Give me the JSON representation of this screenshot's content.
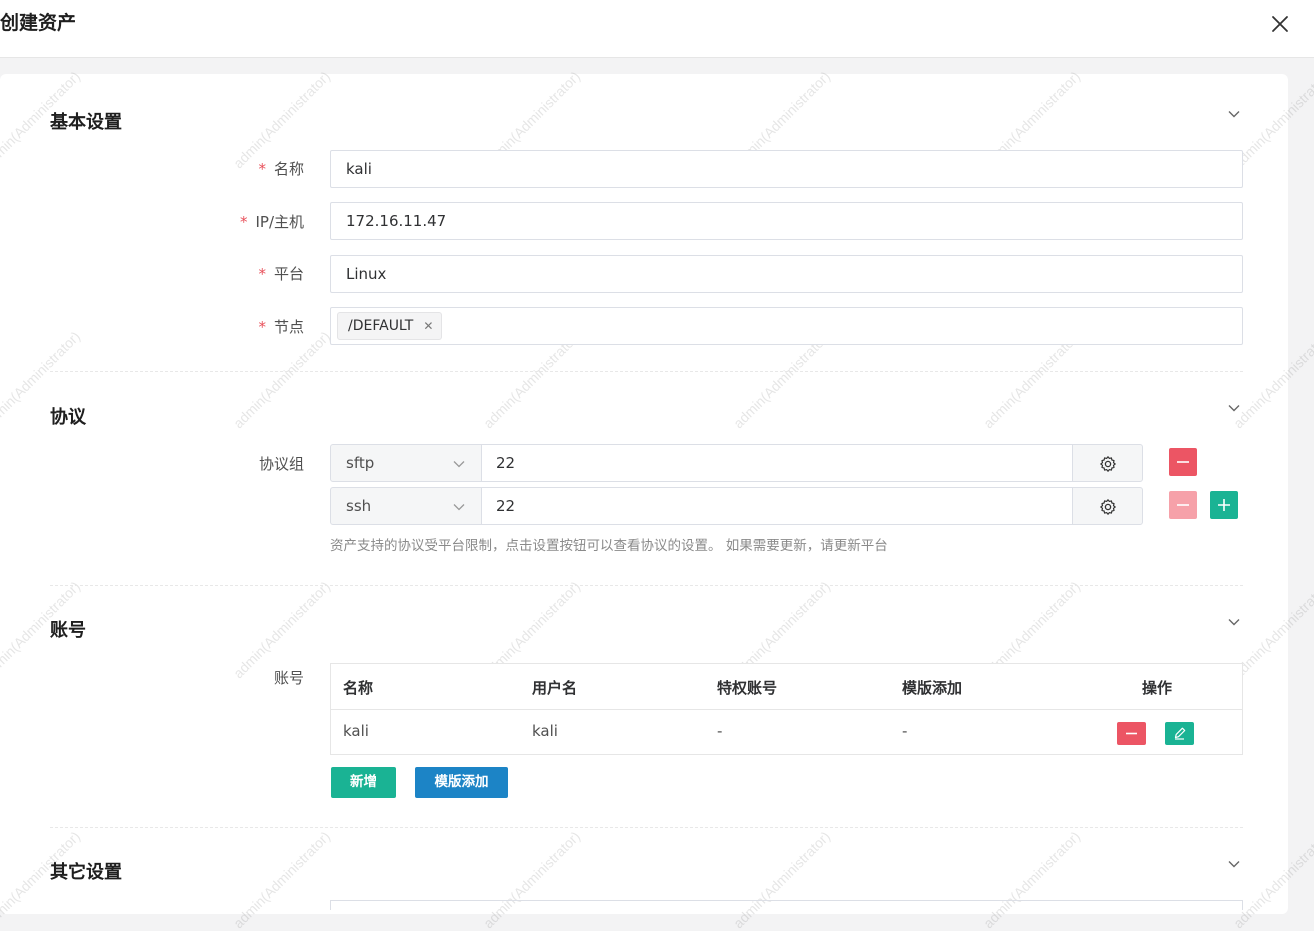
{
  "dialog": {
    "title": "创建资产"
  },
  "watermark": {
    "text": "admin(Administrator)"
  },
  "sections": {
    "basic": {
      "title": "基本设置"
    },
    "protocol": {
      "title": "协议"
    },
    "account": {
      "title": "账号"
    },
    "other": {
      "title": "其它设置"
    }
  },
  "basic": {
    "name_label": "名称",
    "name_value": "kali",
    "ip_label": "IP/主机",
    "ip_value": "172.16.11.47",
    "platform_label": "平台",
    "platform_value": "Linux",
    "node_label": "节点",
    "node_tag": "/DEFAULT",
    "required_mark": "*"
  },
  "protocol": {
    "group_label": "协议组",
    "rows": [
      {
        "protocol": "sftp",
        "port": "22"
      },
      {
        "protocol": "ssh",
        "port": "22"
      }
    ],
    "hint": "资产支持的协议受平台限制，点击设置按钮可以查看协议的设置。 如果需要更新，请更新平台"
  },
  "account": {
    "label": "账号",
    "headers": [
      "名称",
      "用户名",
      "特权账号",
      "模版添加",
      "操作"
    ],
    "rows": [
      {
        "name": "kali",
        "username": "kali",
        "privileged": "-",
        "template": "-"
      }
    ],
    "add_button": "新增",
    "template_button": "模版添加"
  },
  "colors": {
    "danger": "#ec5564",
    "danger_light": "#f6a1a9",
    "primary": "#1ab394",
    "info": "#1c84c6",
    "required": "#e8515b"
  }
}
